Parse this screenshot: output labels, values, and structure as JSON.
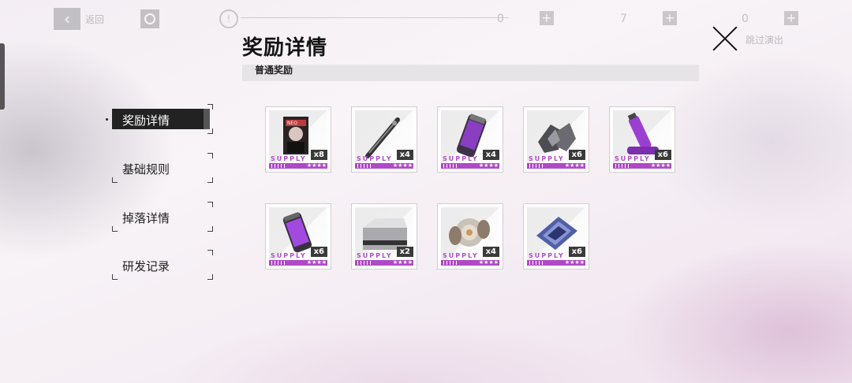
{
  "hud": {
    "back_label": "返回",
    "counters": [
      "0",
      "7",
      "0"
    ],
    "skip_label": "跳过演出"
  },
  "panel": {
    "title": "奖励详情",
    "section": "普通奖励"
  },
  "nav": {
    "items": [
      {
        "label": "奖励详情",
        "active": true
      },
      {
        "label": "基础规则",
        "active": false
      },
      {
        "label": "掉落详情",
        "active": false
      },
      {
        "label": "研发记录",
        "active": false
      }
    ]
  },
  "rewards": [
    {
      "name": "portrait-card",
      "qty": "x8",
      "supply": "SUPPLY",
      "stars": "★★★★",
      "icon": "portrait-card-icon"
    },
    {
      "name": "rod",
      "qty": "x4",
      "supply": "SUPPLY",
      "stars": "★★★★",
      "icon": "rod-icon"
    },
    {
      "name": "purple-capsule",
      "qty": "x4",
      "supply": "SUPPLY",
      "stars": "★★★★",
      "icon": "purple-capsule-icon"
    },
    {
      "name": "crystal-ore",
      "qty": "x6",
      "supply": "SUPPLY",
      "stars": "★★★★",
      "icon": "crystal-ore-icon"
    },
    {
      "name": "battery",
      "qty": "x6",
      "supply": "SUPPLY",
      "stars": "★★★★",
      "icon": "battery-icon"
    },
    {
      "name": "energy-canister",
      "qty": "x6",
      "supply": "SUPPLY",
      "stars": "★★★★",
      "icon": "energy-canister-icon"
    },
    {
      "name": "metal-crate",
      "qty": "x2",
      "supply": "SUPPLY",
      "stars": "★★★★",
      "icon": "metal-crate-icon"
    },
    {
      "name": "sphere-device",
      "qty": "x4",
      "supply": "SUPPLY",
      "stars": "★★★★",
      "icon": "sphere-device-icon"
    },
    {
      "name": "chip-module",
      "qty": "x6",
      "supply": "SUPPLY",
      "stars": "★★★★",
      "icon": "chip-module-icon"
    }
  ]
}
